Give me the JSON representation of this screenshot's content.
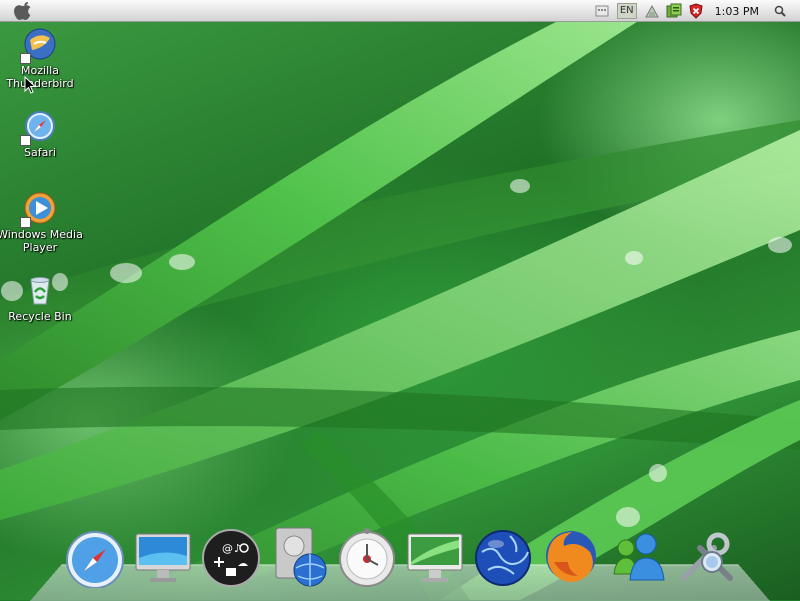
{
  "menubar": {
    "apple_icon": "apple-logo-icon",
    "tray": {
      "language": "EN",
      "icons": [
        "keyboard-icon",
        "network-icon",
        "security-shield-icon"
      ],
      "clock": "1:03 PM",
      "search_icon": "spotlight-search-icon"
    }
  },
  "desktop": {
    "icons": [
      {
        "label_line1": "Mozilla",
        "label_line2": "Thunderbird",
        "icon": "thunderbird-icon"
      },
      {
        "label_line1": "Safari",
        "icon": "safari-icon"
      },
      {
        "label_line1": "Windows Media",
        "label_line2": "Player",
        "icon": "media-player-icon"
      },
      {
        "label_line1": "Recycle Bin",
        "icon": "recycle-bin-icon"
      }
    ]
  },
  "dock": {
    "items": [
      "safari-compass-icon",
      "imac-display-icon",
      "dashboard-icon",
      "network-drive-icon",
      "time-machine-icon",
      "desktop-preview-icon",
      "globe-icon",
      "firefox-icon",
      "messenger-icon",
      "system-tools-icon"
    ]
  },
  "colors": {
    "wallpaper_green": "#1f7a2a",
    "menubar_top": "#fbfbfb",
    "menubar_bottom": "#d2d2d2"
  }
}
